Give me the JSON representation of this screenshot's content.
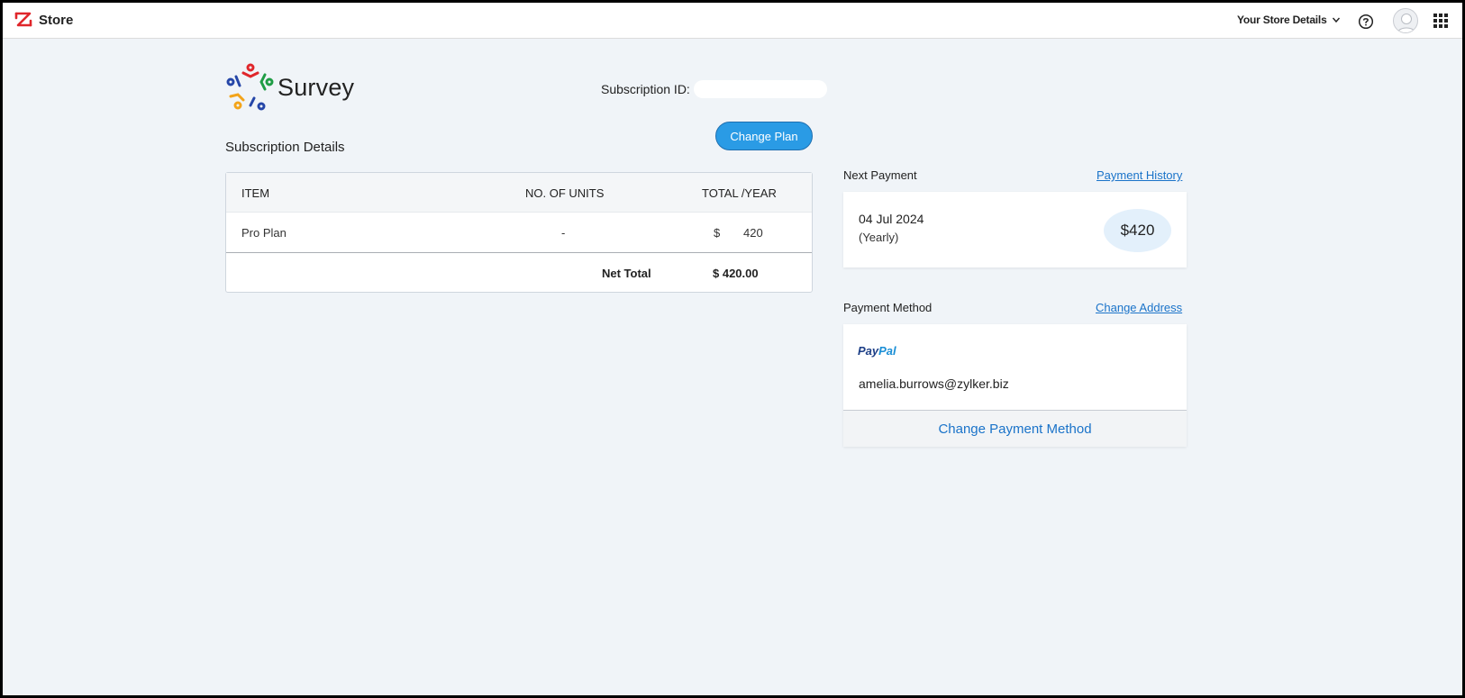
{
  "header": {
    "brand": "Store",
    "store_details": "Your Store Details"
  },
  "product": {
    "name": "Survey",
    "subscription_id_label": "Subscription ID:",
    "subscription_id_value": ""
  },
  "subscription": {
    "title": "Subscription Details",
    "change_plan_label": "Change Plan",
    "columns": {
      "item": "ITEM",
      "units": "NO. OF UNITS",
      "total": "TOTAL /YEAR"
    },
    "rows": [
      {
        "item": "Pro Plan",
        "units": "-",
        "currency": "$",
        "amount": "420"
      }
    ],
    "net_total_label": "Net Total",
    "net_total_value": "$ 420.00"
  },
  "next_payment": {
    "title": "Next Payment",
    "history_link": "Payment History",
    "date": "04 Jul 2024",
    "cycle": "(Yearly)",
    "amount": "$420"
  },
  "payment_method": {
    "title": "Payment Method",
    "change_address_link": "Change Address",
    "provider_pay": "Pay",
    "provider_pal": "Pal",
    "email": "amelia.burrows@zylker.biz",
    "change_method_label": "Change Payment Method"
  },
  "colors": {
    "accent": "#2a9be5",
    "link": "#1a73c9",
    "page_bg": "#f0f4f8"
  }
}
